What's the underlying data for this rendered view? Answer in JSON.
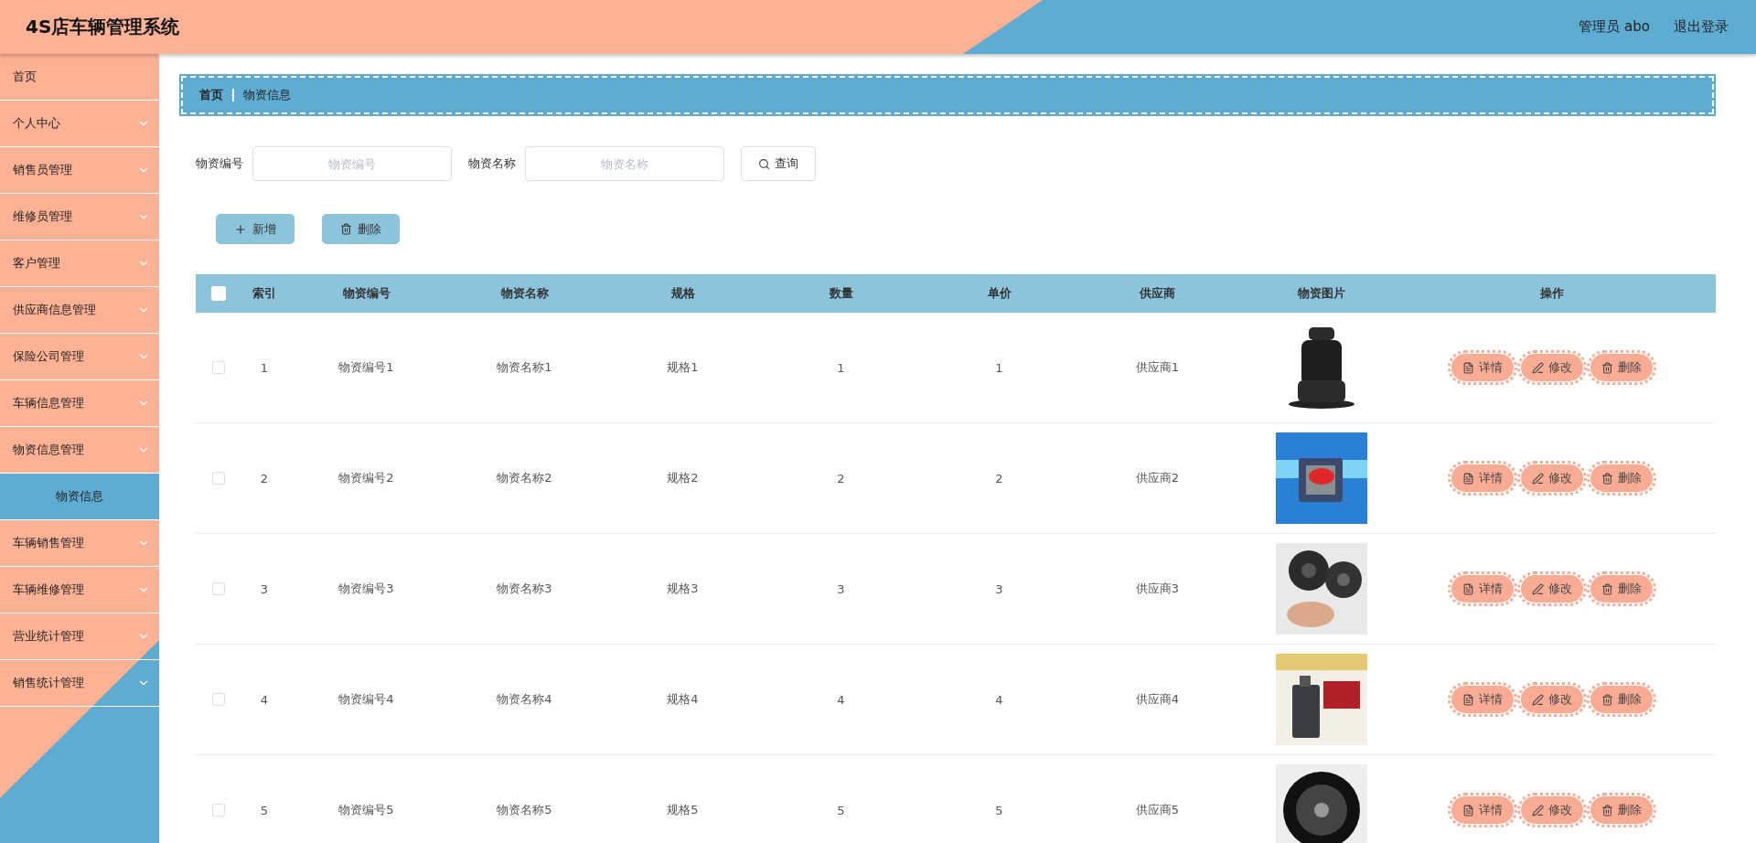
{
  "header": {
    "title": "4S店车辆管理系统",
    "user": "管理员 abo",
    "logout": "退出登录"
  },
  "sidebar": {
    "items": [
      {
        "label": "首页",
        "has_children": false,
        "selected": false
      },
      {
        "label": "个人中心",
        "has_children": true,
        "expanded": false,
        "selected": false
      },
      {
        "label": "销售员管理",
        "has_children": true,
        "expanded": false,
        "selected": false
      },
      {
        "label": "维修员管理",
        "has_children": true,
        "expanded": false,
        "selected": false
      },
      {
        "label": "客户管理",
        "has_children": true,
        "expanded": false,
        "selected": false
      },
      {
        "label": "供应商信息管理",
        "has_children": true,
        "expanded": false,
        "selected": false
      },
      {
        "label": "保险公司管理",
        "has_children": true,
        "expanded": false,
        "selected": false
      },
      {
        "label": "车辆信息管理",
        "has_children": true,
        "expanded": false,
        "selected": false
      },
      {
        "label": "物资信息管理",
        "has_children": true,
        "expanded": true,
        "selected": false,
        "children": [
          {
            "label": "物资信息",
            "selected": true
          }
        ]
      },
      {
        "label": "车辆销售管理",
        "has_children": true,
        "expanded": false,
        "selected": false
      },
      {
        "label": "车辆维修管理",
        "has_children": true,
        "expanded": false,
        "selected": false
      },
      {
        "label": "营业统计管理",
        "has_children": true,
        "expanded": false,
        "selected": false
      },
      {
        "label": "销售统计管理",
        "has_children": true,
        "expanded": false,
        "selected": false
      }
    ]
  },
  "breadcrumb": [
    "首页",
    "物资信息"
  ],
  "search": {
    "fields": [
      {
        "label": "物资编号",
        "placeholder": "物资编号"
      },
      {
        "label": "物资名称",
        "placeholder": "物资名称"
      }
    ],
    "button": "查询"
  },
  "actions": [
    {
      "kind": "add",
      "label": "新增"
    },
    {
      "kind": "delete",
      "label": "删除"
    }
  ],
  "table": {
    "select_all": {
      "checked": false
    },
    "columns": [
      "索引",
      "物资编号",
      "物资名称",
      "规格",
      "数量",
      "单价",
      "供应商",
      "物资图片",
      "操作"
    ],
    "rows": [
      {
        "checked": false,
        "cells": [
          "1",
          "物资编号1",
          "物资名称1",
          "规格1",
          "1",
          "1",
          "供应商1"
        ],
        "actions": [
          {
            "kind": "detail",
            "label": "详情"
          },
          {
            "kind": "edit",
            "label": "修改"
          },
          {
            "kind": "delete",
            "label": "删除"
          }
        ]
      },
      {
        "checked": false,
        "cells": [
          "2",
          "物资编号2",
          "物资名称2",
          "规格2",
          "2",
          "2",
          "供应商2"
        ],
        "actions": [
          {
            "kind": "detail",
            "label": "详情"
          },
          {
            "kind": "edit",
            "label": "修改"
          },
          {
            "kind": "delete",
            "label": "删除"
          }
        ]
      },
      {
        "checked": false,
        "cells": [
          "3",
          "物资编号3",
          "物资名称3",
          "规格3",
          "3",
          "3",
          "供应商3"
        ],
        "actions": [
          {
            "kind": "detail",
            "label": "详情"
          },
          {
            "kind": "edit",
            "label": "修改"
          },
          {
            "kind": "delete",
            "label": "删除"
          }
        ]
      },
      {
        "checked": false,
        "cells": [
          "4",
          "物资编号4",
          "物资名称4",
          "规格4",
          "4",
          "4",
          "供应商4"
        ],
        "actions": [
          {
            "kind": "detail",
            "label": "详情"
          },
          {
            "kind": "edit",
            "label": "修改"
          },
          {
            "kind": "delete",
            "label": "删除"
          }
        ]
      },
      {
        "checked": false,
        "cells": [
          "5",
          "物资编号5",
          "物资名称5",
          "规格5",
          "5",
          "5",
          "供应商5"
        ],
        "actions": [
          {
            "kind": "detail",
            "label": "详情"
          },
          {
            "kind": "edit",
            "label": "修改"
          },
          {
            "kind": "delete",
            "label": "删除"
          }
        ]
      }
    ]
  }
}
